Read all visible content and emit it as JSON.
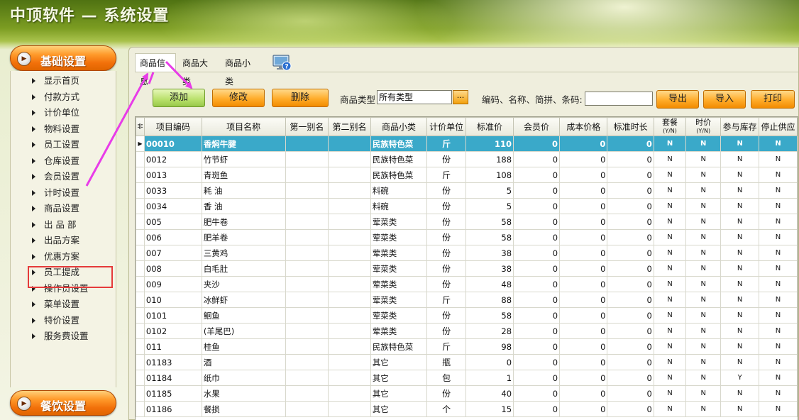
{
  "app": {
    "title": "中顶软件 — 系统设置"
  },
  "sidebar": {
    "group_basic": "基础设置",
    "group_catering": "餐饮设置",
    "items": [
      {
        "label": "显示首页"
      },
      {
        "label": "付款方式"
      },
      {
        "label": "计价单位"
      },
      {
        "label": "物料设置"
      },
      {
        "label": "员工设置"
      },
      {
        "label": "仓库设置"
      },
      {
        "label": "会员设置"
      },
      {
        "label": "计时设置"
      },
      {
        "label": "商品设置"
      },
      {
        "label": "出 品 部"
      },
      {
        "label": "出品方案"
      },
      {
        "label": "优惠方案"
      },
      {
        "label": "员工提成"
      },
      {
        "label": "操作员设置"
      },
      {
        "label": "菜单设置"
      },
      {
        "label": "特价设置"
      },
      {
        "label": "服务费设置"
      }
    ]
  },
  "tabs": [
    "商品信息",
    "商品大类",
    "商品小类"
  ],
  "toolbar": {
    "add": "添加",
    "edit": "修改",
    "delete": "删除",
    "type_label": "商品类型",
    "type_value": "所有类型",
    "type_browse": "...",
    "search_label": "编码、名称、简拼、条码:",
    "search_value": "",
    "export": "导出",
    "import": "导入",
    "print": "打印"
  },
  "colors": {
    "accent_orange": "#f28b00",
    "selected_row": "#3aa9c9",
    "annotation_magenta": "#e83ce8",
    "highlight_red": "#e53a3a"
  },
  "grid": {
    "indicator_header": "非",
    "columns": [
      {
        "label": "项目编码"
      },
      {
        "label": "项目名称"
      },
      {
        "label": "第一别名"
      },
      {
        "label": "第二别名"
      },
      {
        "label": "商品小类"
      },
      {
        "label": "计价单位"
      },
      {
        "label": "标准价"
      },
      {
        "label": "会员价"
      },
      {
        "label": "成本价格"
      },
      {
        "label": "标准时长"
      },
      {
        "label": "套餐",
        "sub": "(Y/N)"
      },
      {
        "label": "时价",
        "sub": "(Y/N)"
      },
      {
        "label": "参与库存"
      },
      {
        "label": "停止供应"
      }
    ],
    "rows": [
      {
        "selected": true,
        "cells": [
          "00010",
          "香焖牛腱",
          "",
          "",
          "民族特色菜",
          "斤",
          "110",
          "0",
          "0",
          "0",
          "N",
          "N",
          "N",
          "N"
        ]
      },
      {
        "cells": [
          "0012",
          "竹节虾",
          "",
          "",
          "民族特色菜",
          "份",
          "188",
          "0",
          "0",
          "0",
          "N",
          "N",
          "N",
          "N"
        ]
      },
      {
        "cells": [
          "0013",
          "青斑鱼",
          "",
          "",
          "民族特色菜",
          "斤",
          "108",
          "0",
          "0",
          "0",
          "N",
          "N",
          "N",
          "N"
        ]
      },
      {
        "cells": [
          "0033",
          "耗 油",
          "",
          "",
          "料碗",
          "份",
          "5",
          "0",
          "0",
          "0",
          "N",
          "N",
          "N",
          "N"
        ]
      },
      {
        "cells": [
          "0034",
          "香 油",
          "",
          "",
          "料碗",
          "份",
          "5",
          "0",
          "0",
          "0",
          "N",
          "N",
          "N",
          "N"
        ]
      },
      {
        "cells": [
          "005",
          "肥牛卷",
          "",
          "",
          "荤菜类",
          "份",
          "58",
          "0",
          "0",
          "0",
          "N",
          "N",
          "N",
          "N"
        ]
      },
      {
        "cells": [
          "006",
          "肥羊卷",
          "",
          "",
          "荤菜类",
          "份",
          "58",
          "0",
          "0",
          "0",
          "N",
          "N",
          "N",
          "N"
        ]
      },
      {
        "cells": [
          "007",
          "三黄鸡",
          "",
          "",
          "荤菜类",
          "份",
          "38",
          "0",
          "0",
          "0",
          "N",
          "N",
          "N",
          "N"
        ]
      },
      {
        "cells": [
          "008",
          "白毛肚",
          "",
          "",
          "荤菜类",
          "份",
          "38",
          "0",
          "0",
          "0",
          "N",
          "N",
          "N",
          "N"
        ]
      },
      {
        "cells": [
          "009",
          "夹沙",
          "",
          "",
          "荤菜类",
          "份",
          "48",
          "0",
          "0",
          "0",
          "N",
          "N",
          "N",
          "N"
        ]
      },
      {
        "cells": [
          "010",
          "冰鲜虾",
          "",
          "",
          "荤菜类",
          "斤",
          "88",
          "0",
          "0",
          "0",
          "N",
          "N",
          "N",
          "N"
        ]
      },
      {
        "cells": [
          "0101",
          "鮰鱼",
          "",
          "",
          "荤菜类",
          "份",
          "58",
          "0",
          "0",
          "0",
          "N",
          "N",
          "N",
          "N"
        ]
      },
      {
        "cells": [
          "0102",
          "(羊尾巴)",
          "",
          "",
          "荤菜类",
          "份",
          "28",
          "0",
          "0",
          "0",
          "N",
          "N",
          "N",
          "N"
        ]
      },
      {
        "cells": [
          "011",
          "桂鱼",
          "",
          "",
          "民族特色菜",
          "斤",
          "98",
          "0",
          "0",
          "0",
          "N",
          "N",
          "N",
          "N"
        ]
      },
      {
        "cells": [
          "01183",
          "酒",
          "",
          "",
          "其它",
          "瓶",
          "0",
          "0",
          "0",
          "0",
          "N",
          "N",
          "N",
          "N"
        ]
      },
      {
        "cells": [
          "01184",
          "纸巾",
          "",
          "",
          "其它",
          "包",
          "1",
          "0",
          "0",
          "0",
          "N",
          "N",
          "Y",
          "N"
        ]
      },
      {
        "cells": [
          "01185",
          "水果",
          "",
          "",
          "其它",
          "份",
          "40",
          "0",
          "0",
          "0",
          "N",
          "N",
          "N",
          "N"
        ]
      },
      {
        "cells": [
          "01186",
          "餐损",
          "",
          "",
          "其它",
          "个",
          "15",
          "0",
          "0",
          "0",
          "N",
          "N",
          "N",
          "N"
        ]
      }
    ]
  }
}
